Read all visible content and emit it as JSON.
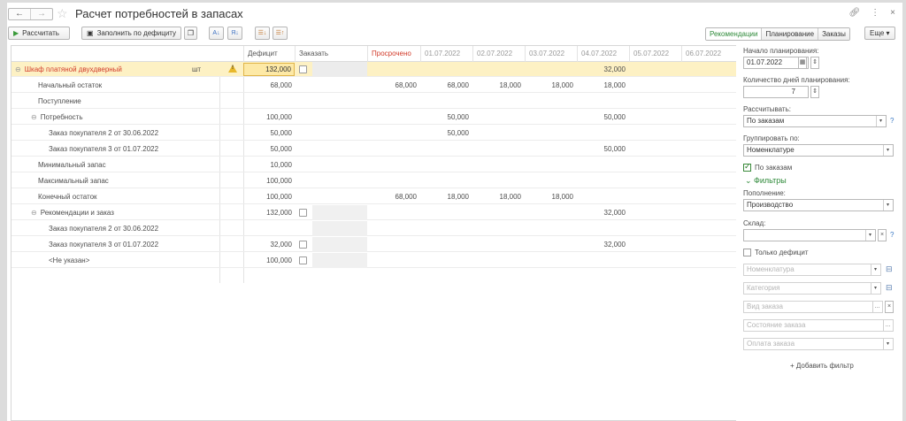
{
  "window": {
    "title": "Расчет потребностей в запасах",
    "nav_back": "←",
    "nav_forward": "→",
    "star": "☆",
    "link_icon": "🔗",
    "more_icon": "⋮",
    "close_icon": "×"
  },
  "toolbar": {
    "calculate_label": "Рассчитать",
    "fill_deficit_label": "Заполнить по дефициту",
    "views": [
      "Рекомендации",
      "Планирование",
      "Заказы"
    ],
    "more_label": "Еще ▾"
  },
  "grid": {
    "headers": {
      "deficit": "Дефицит",
      "order": "Заказать",
      "overdue": "Просрочено",
      "dates": [
        "01.07.2022",
        "02.07.2022",
        "03.07.2022",
        "04.07.2022",
        "05.07.2022",
        "06.07.2022"
      ]
    },
    "rows": [
      {
        "label": "Шкаф платяной двухдверный",
        "unit": "шт",
        "deficit": "132,000",
        "overdue": "",
        "d": [
          "",
          "",
          "",
          "32,000",
          "",
          ""
        ]
      },
      {
        "label": "Начальный остаток",
        "deficit": "68,000",
        "overdue": "68,000",
        "d": [
          "68,000",
          "18,000",
          "18,000",
          "18,000",
          "",
          ""
        ]
      },
      {
        "label": "Поступление",
        "deficit": "",
        "overdue": "",
        "d": [
          "",
          "",
          "",
          "",
          "",
          ""
        ]
      },
      {
        "label": "Потребность",
        "deficit": "100,000",
        "overdue": "",
        "d": [
          "50,000",
          "",
          "",
          "50,000",
          "",
          ""
        ]
      },
      {
        "label": "Заказ покупателя 2 от 30.06.2022",
        "deficit": "50,000",
        "overdue": "",
        "d": [
          "50,000",
          "",
          "",
          "",
          "",
          ""
        ]
      },
      {
        "label": "Заказ покупателя 3 от 01.07.2022",
        "deficit": "50,000",
        "overdue": "",
        "d": [
          "",
          "",
          "",
          "50,000",
          "",
          ""
        ]
      },
      {
        "label": "Минимальный запас",
        "deficit": "10,000",
        "overdue": "",
        "d": [
          "",
          "",
          "",
          "",
          "",
          ""
        ]
      },
      {
        "label": "Максимальный запас",
        "deficit": "100,000",
        "overdue": "",
        "d": [
          "",
          "",
          "",
          "",
          "",
          ""
        ]
      },
      {
        "label": "Конечный остаток",
        "deficit": "100,000",
        "overdue": "68,000",
        "d": [
          "18,000",
          "18,000",
          "18,000",
          "",
          "",
          ""
        ]
      },
      {
        "label": "Рекомендации и заказ",
        "deficit": "132,000",
        "overdue": "",
        "d": [
          "",
          "",
          "",
          "32,000",
          "",
          ""
        ]
      },
      {
        "label": "Заказ покупателя 2 от 30.06.2022",
        "deficit": "",
        "overdue": "",
        "d": [
          "",
          "",
          "",
          "",
          "",
          ""
        ]
      },
      {
        "label": "Заказ покупателя 3 от 01.07.2022",
        "deficit": "32,000",
        "overdue": "",
        "d": [
          "",
          "",
          "",
          "32,000",
          "",
          ""
        ]
      },
      {
        "label": "<Не указан>",
        "deficit": "100,000",
        "overdue": "",
        "d": [
          "",
          "",
          "",
          "",
          "",
          ""
        ]
      }
    ]
  },
  "panel": {
    "start_label": "Начало планирования:",
    "start_value": "01.07.2022",
    "days_label": "Количество дней планирования:",
    "days_value": "7",
    "calc_label": "Рассчитывать:",
    "calc_value": "По заказам",
    "group_label": "Группировать по:",
    "group_value": "Номенклатуре",
    "by_orders_label": "По заказам",
    "filters_label": "Фильтры",
    "supply_label": "Пополнение:",
    "supply_value": "Производство",
    "warehouse_label": "Склад:",
    "warehouse_value": "",
    "deficit_only_label": "Только дефицит",
    "nomenclature_placeholder": "Номенклатура",
    "category_placeholder": "Категория",
    "order_type_placeholder": "Вид заказа",
    "order_state_placeholder": "Состояние заказа",
    "order_payment_placeholder": "Оплата заказа",
    "add_filter_label": "+ Добавить фильтр"
  },
  "colors": {
    "accent_green": "#2f8a3a",
    "red": "#d23b2a",
    "selection": "#fdf1c4",
    "deficit_box": "#fde9a6"
  }
}
